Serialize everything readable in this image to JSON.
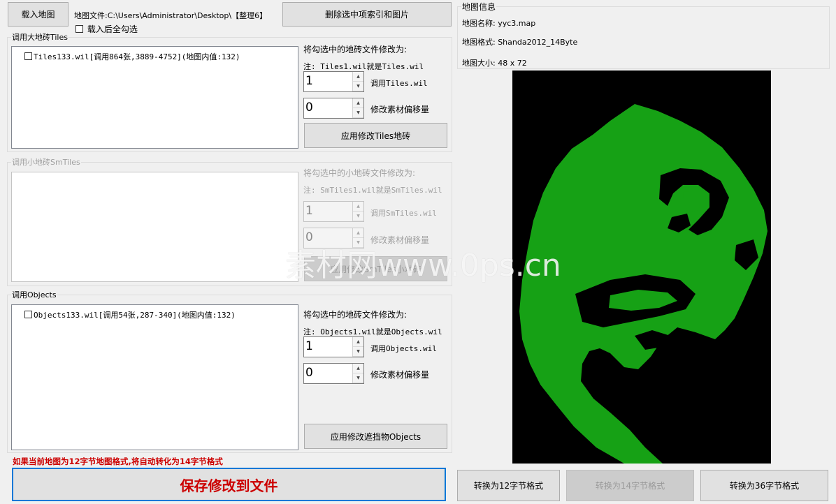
{
  "toolbar": {
    "load_map": "载入地图",
    "map_file_label": "地图文件:C:\\Users\\Administrator\\Desktop\\【整理6】",
    "delete_selected": "删除选中项索引和图片",
    "check_all_after_load": "载入后全勾选"
  },
  "tiles_group": {
    "title": "调用大地砖Tiles",
    "items": [
      "Tiles133.wil[调用864张,3889-4752](地图内值:132)"
    ],
    "change_to": "将勾选中的地砖文件修改为:",
    "note": "注: Tiles1.wil就是Tiles.wil",
    "file_index": "1",
    "file_label": "调用Tiles.wil",
    "offset": "0",
    "offset_label": "修改素材偏移量",
    "apply": "应用修改Tiles地砖"
  },
  "smtiles_group": {
    "title": "调用小地砖SmTiles",
    "change_to": "将勾选中的小地砖文件修改为:",
    "note": "注: SmTiles1.wil就是SmTiles.wil",
    "file_index": "1",
    "file_label": "调用SmTiles.wil",
    "offset": "0",
    "offset_label": "修改素材偏移量",
    "apply": "应用修改SmTiles小地砖"
  },
  "objects_group": {
    "title": "调用Objects",
    "items": [
      "Objects133.wil[调用54张,287-340](地图内值:132)"
    ],
    "change_to": "将勾选中的地砖文件修改为:",
    "note": "注: Objects1.wil就是Objects.wil",
    "file_index": "1",
    "file_label": "调用Objects.wil",
    "offset": "0",
    "offset_label": "修改素材偏移量",
    "apply": "应用修改遮挡物Objects"
  },
  "footer": {
    "warning": "如果当前地图为12字节地图格式,将自动转化为14字节格式",
    "save": "保存修改到文件"
  },
  "map_info": {
    "title": "地图信息",
    "name": "地图名称: yyc3.map",
    "format": "地图格式: Shanda2012_14Byte",
    "size": "地图大小: 48 x 72"
  },
  "convert": {
    "to12": "转换为12字节格式",
    "to14": "转换为14字节格式",
    "to36": "转换为36字节格式"
  },
  "watermark": "素材网www.0ps.cn",
  "colors": {
    "map_green": "#16a115",
    "map_black": "#000000",
    "warning_red": "#cc0000",
    "save_text_red": "#cc0000",
    "focus_border": "#0078d7"
  }
}
